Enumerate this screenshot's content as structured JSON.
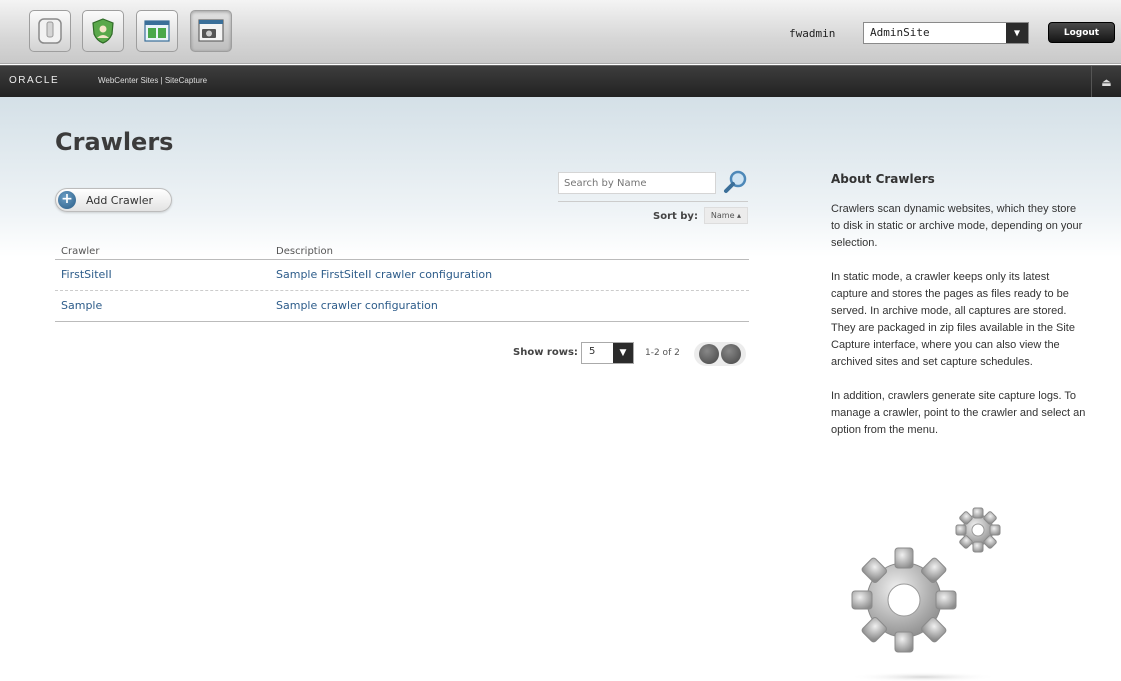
{
  "toolbar": {
    "apps": [
      {
        "icon": "contributor-app-icon"
      },
      {
        "icon": "admin-app-icon"
      },
      {
        "icon": "marketing-app-icon"
      },
      {
        "icon": "site-capture-app-icon"
      }
    ],
    "user": "fwadmin",
    "site": "AdminSite",
    "logout_label": "Logout"
  },
  "brand": {
    "oracle": "ORACLE",
    "product": "WebCenter Sites | SiteCapture"
  },
  "page": {
    "title": "Crawlers",
    "add_label": "Add Crawler",
    "search_placeholder": "Search by Name",
    "sort_label": "Sort by:",
    "sort_value": "Name ▴"
  },
  "table": {
    "headers": [
      "Crawler",
      "Description"
    ],
    "rows": [
      {
        "name": "FirstSiteII",
        "description": "Sample FirstSiteII crawler configuration"
      },
      {
        "name": "Sample",
        "description": "Sample crawler configuration"
      }
    ]
  },
  "pagination": {
    "rows_label": "Show rows:",
    "rows_value": "5",
    "range": "1-2 of 2"
  },
  "about": {
    "title": "About Crawlers",
    "paragraphs": [
      "Crawlers scan dynamic websites, which they store to disk in static or archive mode, depending on your selection.",
      "In static mode, a crawler keeps only its latest capture and stores the pages as files ready to be served. In archive mode, all captures are stored. They are packaged in zip files available in the Site Capture interface, where you can also view the archived sites and set capture schedules.",
      "In addition, crawlers generate site capture logs. To manage a crawler, point to the crawler and select an option from the menu."
    ]
  }
}
